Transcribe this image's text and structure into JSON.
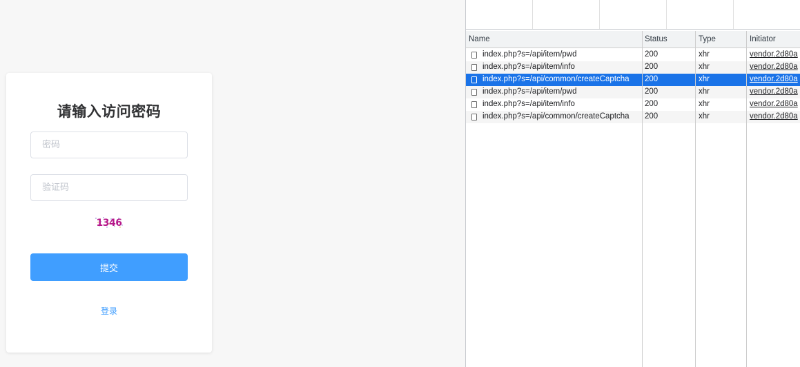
{
  "login": {
    "title": "请输入访问密码",
    "password_placeholder": "密码",
    "captcha_placeholder": "验证码",
    "captcha_text": "1346",
    "submit_label": "提交",
    "login_link": "登录"
  },
  "devtools": {
    "columns": {
      "name": "Name",
      "status": "Status",
      "type": "Type",
      "initiator": "Initiator"
    },
    "requests": [
      {
        "name": "index.php?s=/api/item/pwd",
        "status": "200",
        "type": "xhr",
        "initiator": "vendor.2d80a",
        "selected": false
      },
      {
        "name": "index.php?s=/api/item/info",
        "status": "200",
        "type": "xhr",
        "initiator": "vendor.2d80a",
        "selected": false
      },
      {
        "name": "index.php?s=/api/common/createCaptcha",
        "status": "200",
        "type": "xhr",
        "initiator": "vendor.2d80a",
        "selected": true
      },
      {
        "name": "index.php?s=/api/item/pwd",
        "status": "200",
        "type": "xhr",
        "initiator": "vendor.2d80a",
        "selected": false
      },
      {
        "name": "index.php?s=/api/item/info",
        "status": "200",
        "type": "xhr",
        "initiator": "vendor.2d80a",
        "selected": false
      },
      {
        "name": "index.php?s=/api/common/createCaptcha",
        "status": "200",
        "type": "xhr",
        "initiator": "vendor.2d80a",
        "selected": false
      }
    ],
    "colors": {
      "selected_row": "#1a73e8",
      "stripe_row": "#f5f5f5"
    }
  },
  "colors": {
    "accent": "#409eff",
    "captcha_text": "#b5178a"
  }
}
